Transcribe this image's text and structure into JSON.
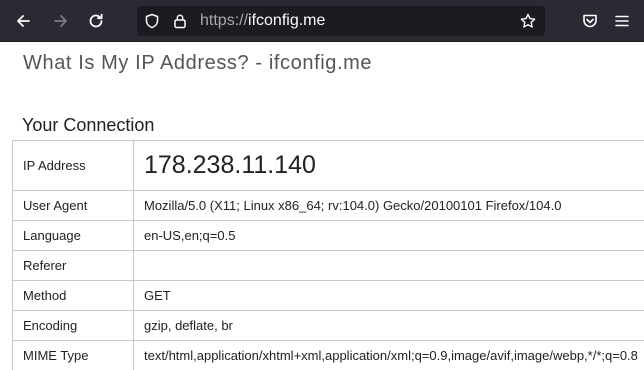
{
  "browser": {
    "url_scheme": "https://",
    "url_host": "ifconfig.me",
    "icons": {
      "back": "back-arrow-icon",
      "forward": "forward-arrow-icon",
      "reload": "reload-icon",
      "tracking": "shield-icon",
      "lock": "lock-icon",
      "bookmark": "star-icon",
      "pocket": "pocket-icon",
      "menu": "hamburger-menu-icon"
    }
  },
  "page": {
    "title": "What Is My IP Address? - ifconfig.me",
    "section_title": "Your Connection",
    "rows": [
      {
        "label": "IP Address",
        "value": "178.238.11.140"
      },
      {
        "label": "User Agent",
        "value": "Mozilla/5.0 (X11; Linux x86_64; rv:104.0) Gecko/20100101 Firefox/104.0"
      },
      {
        "label": "Language",
        "value": "en-US,en;q=0.5"
      },
      {
        "label": "Referer",
        "value": ""
      },
      {
        "label": "Method",
        "value": "GET"
      },
      {
        "label": "Encoding",
        "value": "gzip, deflate, br"
      },
      {
        "label": "MIME Type",
        "value": "text/html,application/xhtml+xml,application/xml;q=0.9,image/avif,image/webp,*/*;q=0.8"
      }
    ]
  }
}
